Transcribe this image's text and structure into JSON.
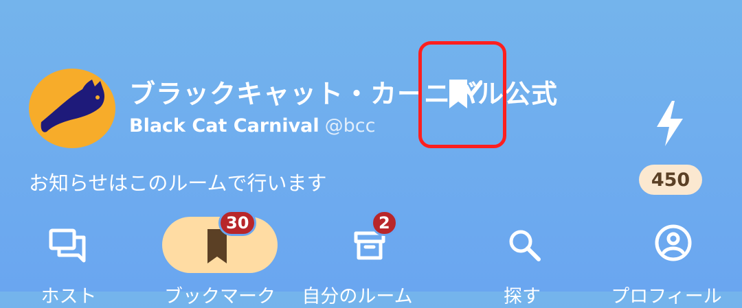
{
  "header": {
    "title": "ブラックキャット・カーニバル公式",
    "name": "Black Cat Carnival",
    "handle": "@bcc",
    "description": "お知らせはこのルームで行います",
    "verified_icon": "bookmark-check-icon",
    "score_icon": "lightning-icon",
    "score": "450"
  },
  "nav": {
    "items": [
      {
        "id": "rooms",
        "icon": "chat-bubbles-icon",
        "label": "ホスト",
        "badge": ""
      },
      {
        "id": "bookmarks",
        "icon": "bookmark-icon",
        "label": "ブックマーク",
        "badge": "30",
        "active": true
      },
      {
        "id": "my-rooms",
        "icon": "box-icon",
        "label": "自分のルーム",
        "badge": "2"
      },
      {
        "id": "search",
        "icon": "search-icon",
        "label": "探す",
        "badge": ""
      },
      {
        "id": "profile",
        "icon": "profile-icon",
        "label": "プロフィール",
        "badge": ""
      }
    ]
  },
  "colors": {
    "background": "#6faef0",
    "avatar_bg": "#f7ac2a",
    "active_pill": "#ffdca3",
    "badge_red": "#b8262a",
    "highlight_red": "#ff1f1f",
    "count_bg": "#fbe8d0"
  }
}
